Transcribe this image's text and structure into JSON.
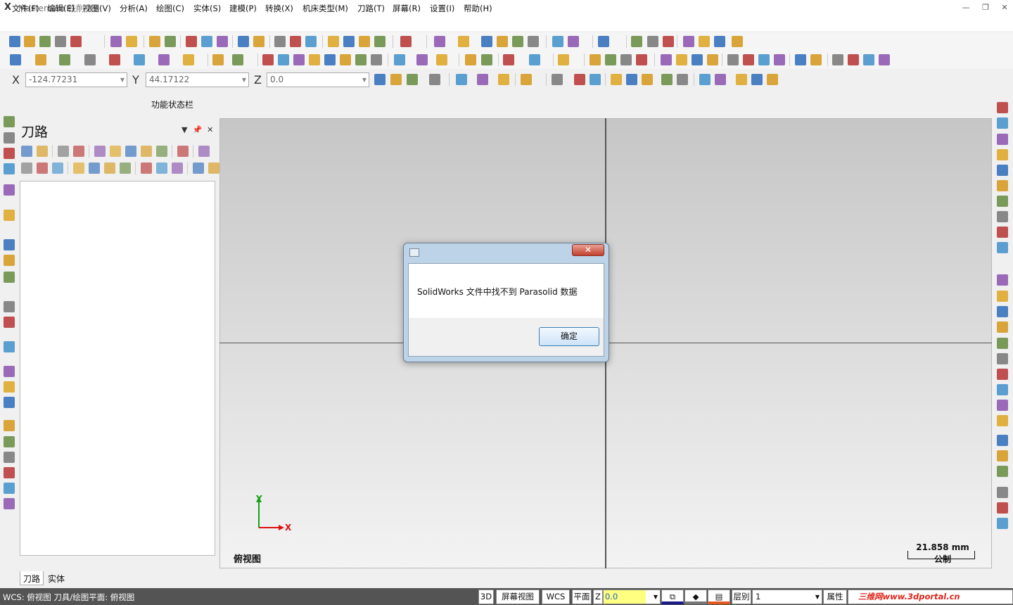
{
  "window": {
    "title": "Mastercam 铣削 X9",
    "logo": "X"
  },
  "menus": [
    "文件(F)",
    "编辑(E)",
    "视图(V)",
    "分析(A)",
    "绘图(C)",
    "实体(S)",
    "建模(P)",
    "转换(X)",
    "机床类型(M)",
    "刀路(T)",
    "屏幕(R)",
    "设置(I)",
    "帮助(H)"
  ],
  "coords": {
    "x_label": "X",
    "x_value": "-124.77231",
    "y_label": "Y",
    "y_value": "44.17122",
    "z_label": "Z",
    "z_value": "0.0"
  },
  "function_status_bar": "功能状态栏",
  "panel": {
    "title": "刀路",
    "tabs": [
      "刀路",
      "实体"
    ]
  },
  "viewport": {
    "view_name": "俯视图",
    "axis_x": "X",
    "axis_y": "Y",
    "scale_value": "21.858 mm",
    "scale_unit": "公制"
  },
  "dialog": {
    "message": "SolidWorks 文件中找不到 Parasolid 数据",
    "ok_label": "确定",
    "close_label": "✕"
  },
  "statusbar": {
    "text": "WCS: 俯视图  刀具/绘图平面: 俯视图",
    "mode_3d": "3D",
    "screen_view": "屏幕视图",
    "wcs": "WCS",
    "plane": "平面",
    "z_label": "Z",
    "z_value": "0.0",
    "level_label": "层别",
    "level_value": "1",
    "attributes": "属性",
    "watermark": "三维网www.3dportal.cn"
  },
  "colors": {
    "accent_blue": "#1f5fc8",
    "axis_green": "#16a016",
    "axis_red": "#d11",
    "z_field_yellow": "#ffff80"
  }
}
